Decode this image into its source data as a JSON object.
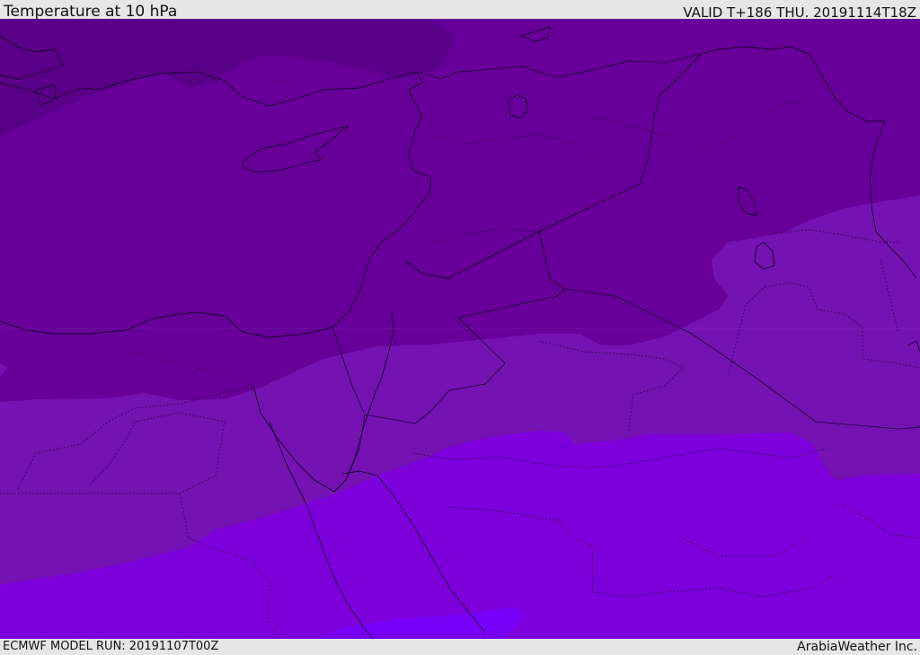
{
  "header": {
    "title": "Temperature at 10 hPa",
    "valid_time": "VALID T+186 THU. 20191114T18Z"
  },
  "footer": {
    "model_run": "ECMWF MODEL RUN: 20191107T00Z",
    "credit": "ArabiaWeather Inc."
  },
  "colors": {
    "band_coldest": "#5a0088",
    "band_cold": "#660098",
    "band_mid": "#7512b2",
    "band_warm": "#7d00dc",
    "band_warmest": "#7800f8",
    "border_line": "#1a0030"
  }
}
